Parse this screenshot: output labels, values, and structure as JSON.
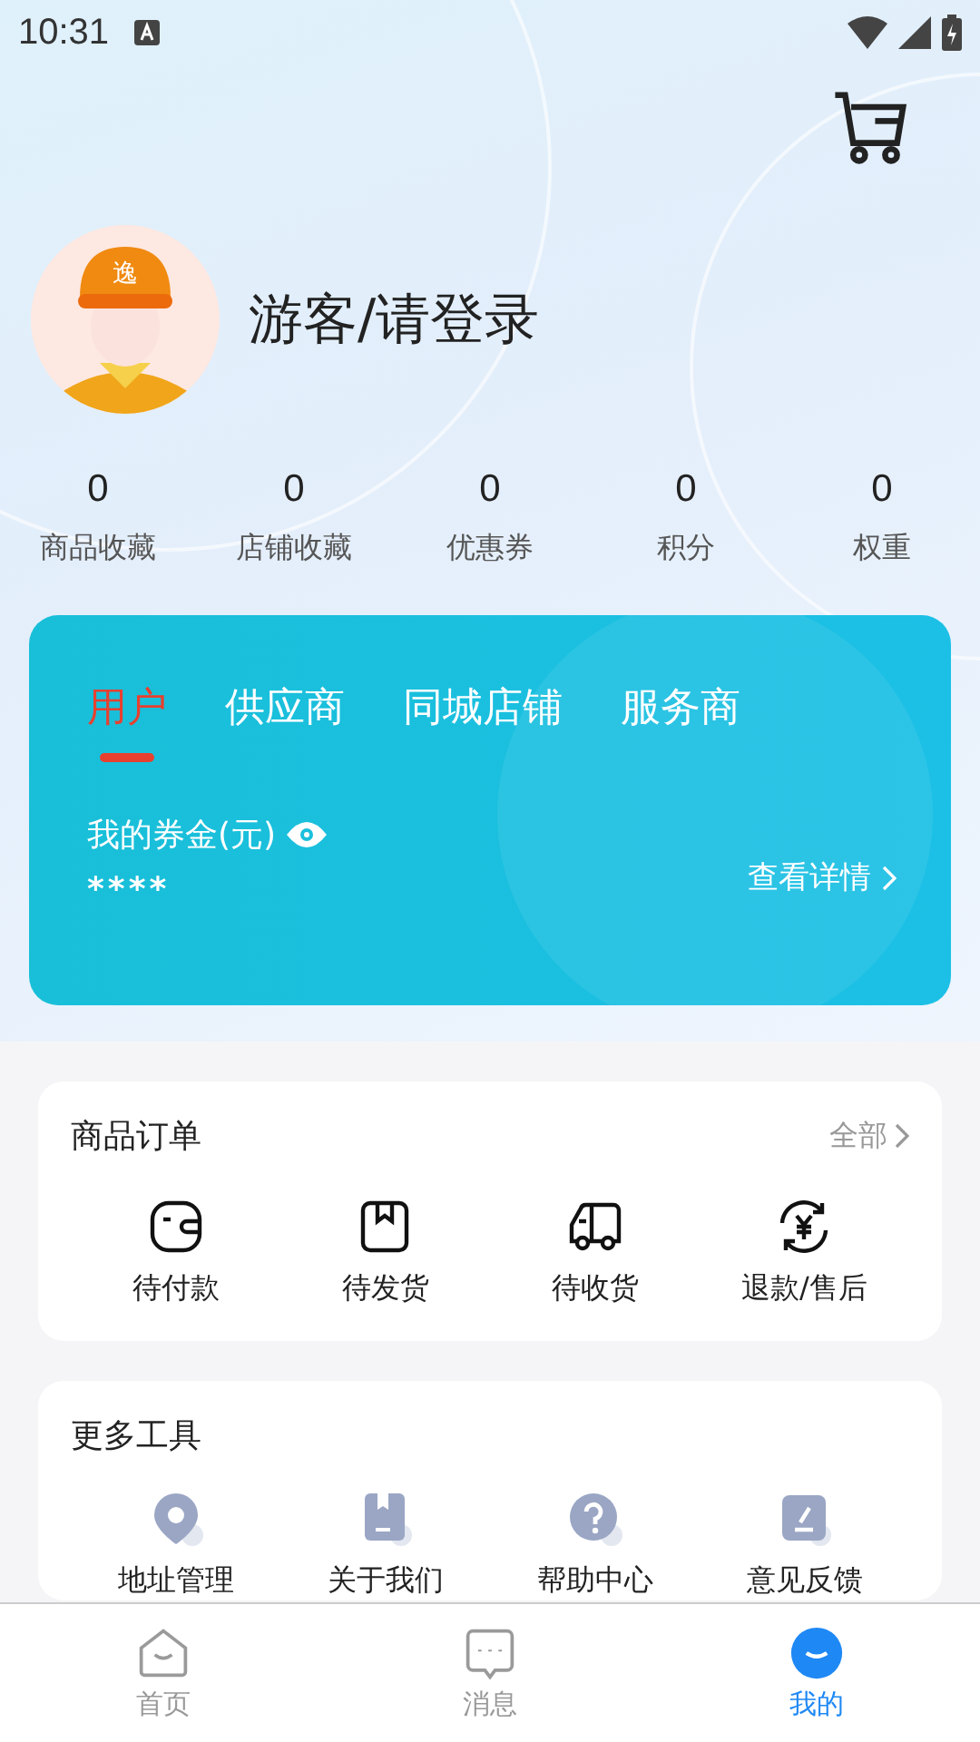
{
  "status_bar": {
    "time": "10:31"
  },
  "profile": {
    "avatar_cap_label": "逸",
    "name": "游客/请登录"
  },
  "stats": [
    {
      "value": "0",
      "label": "商品收藏"
    },
    {
      "value": "0",
      "label": "店铺收藏"
    },
    {
      "value": "0",
      "label": "优惠券"
    },
    {
      "value": "0",
      "label": "积分"
    },
    {
      "value": "0",
      "label": "权重"
    }
  ],
  "role_card": {
    "tabs": [
      {
        "label": "用户",
        "selected": true
      },
      {
        "label": "供应商",
        "selected": false
      },
      {
        "label": "同城店铺",
        "selected": false
      },
      {
        "label": "服务商",
        "selected": false
      }
    ],
    "balance_label": "我的券金(元)",
    "balance_value": "****",
    "details_link": "查看详情"
  },
  "orders": {
    "title": "商品订单",
    "all_link": "全部",
    "items": [
      {
        "kind": "wallet",
        "label": "待付款"
      },
      {
        "kind": "box",
        "label": "待发货"
      },
      {
        "kind": "truck",
        "label": "待收货"
      },
      {
        "kind": "refund",
        "label": "退款/售后"
      }
    ]
  },
  "tools": {
    "title": "更多工具",
    "items": [
      {
        "kind": "pin",
        "label": "地址管理"
      },
      {
        "kind": "book",
        "label": "关于我们"
      },
      {
        "kind": "help",
        "label": "帮助中心"
      },
      {
        "kind": "edit",
        "label": "意见反馈"
      }
    ]
  },
  "bottom_nav": [
    {
      "kind": "home",
      "label": "首页",
      "selected": false
    },
    {
      "kind": "message",
      "label": "消息",
      "selected": false
    },
    {
      "kind": "mine",
      "label": "我的",
      "selected": true
    }
  ]
}
